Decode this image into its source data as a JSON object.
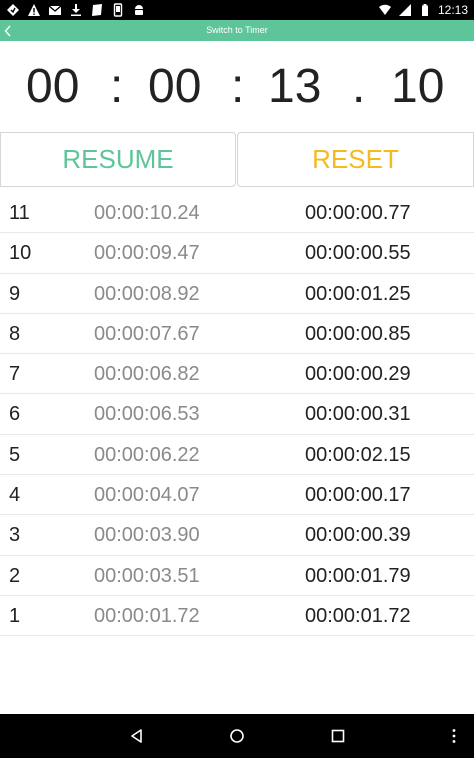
{
  "status_bar": {
    "time": "12:13",
    "left_icons": [
      "location-icon",
      "warning-icon",
      "gmail-icon",
      "download-icon",
      "pages-icon",
      "phone-icon",
      "android-icon"
    ],
    "right_icons": [
      "wifi-icon",
      "signal-icon",
      "battery-icon"
    ]
  },
  "top_bar": {
    "title": "Switch to Timer",
    "accent_color": "#5ec49a"
  },
  "timer": {
    "hours": "00",
    "minutes": "00",
    "seconds": "13",
    "hundredths": "10",
    "sep_colon": ":",
    "sep_dot": "."
  },
  "buttons": {
    "resume_label": "RESUME",
    "reset_label": "RESET",
    "resume_color": "#5ec49a",
    "reset_color": "#f5ba1d"
  },
  "laps": [
    {
      "num": "11",
      "total": "00:00:10.24",
      "split": "00:00:00.77"
    },
    {
      "num": "10",
      "total": "00:00:09.47",
      "split": "00:00:00.55"
    },
    {
      "num": "9",
      "total": "00:00:08.92",
      "split": "00:00:01.25"
    },
    {
      "num": "8",
      "total": "00:00:07.67",
      "split": "00:00:00.85"
    },
    {
      "num": "7",
      "total": "00:00:06.82",
      "split": "00:00:00.29"
    },
    {
      "num": "6",
      "total": "00:00:06.53",
      "split": "00:00:00.31"
    },
    {
      "num": "5",
      "total": "00:00:06.22",
      "split": "00:00:02.15"
    },
    {
      "num": "4",
      "total": "00:00:04.07",
      "split": "00:00:00.17"
    },
    {
      "num": "3",
      "total": "00:00:03.90",
      "split": "00:00:00.39"
    },
    {
      "num": "2",
      "total": "00:00:03.51",
      "split": "00:00:01.79"
    },
    {
      "num": "1",
      "total": "00:00:01.72",
      "split": "00:00:01.72"
    }
  ],
  "nav_bar": {
    "icons": [
      "back-triangle-icon",
      "home-circle-icon",
      "recents-square-icon",
      "overflow-menu-icon"
    ]
  }
}
